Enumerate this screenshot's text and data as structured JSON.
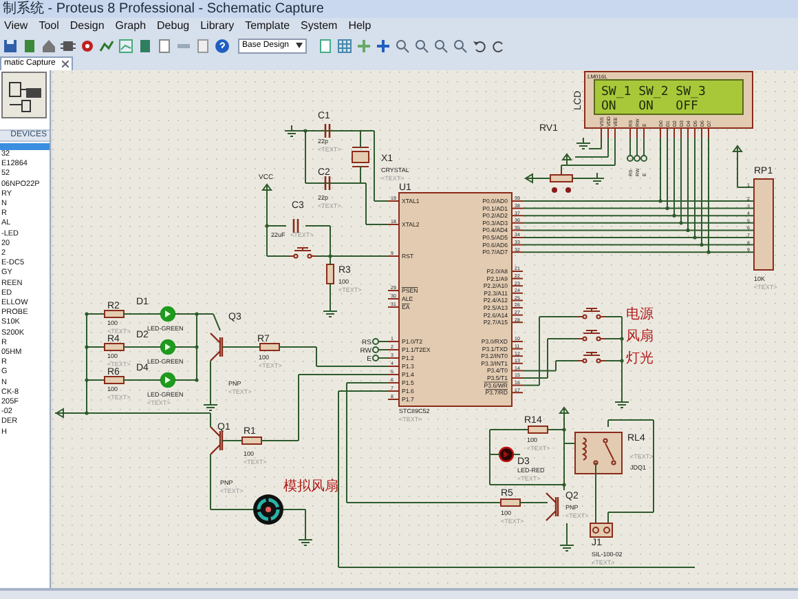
{
  "window": {
    "title": "制系统 - Proteus 8 Professional - Schematic Capture"
  },
  "menu": [
    "View",
    "Tool",
    "Design",
    "Graph",
    "Debug",
    "Library",
    "Template",
    "System",
    "Help"
  ],
  "toolbar": {
    "layer_select": "Base Design"
  },
  "tab": {
    "label": "matic Capture",
    "selected": true
  },
  "devices_panel": {
    "header": "DEVICES",
    "items": [
      "32",
      "E12864",
      "52",
      "06NPO22P",
      "RY",
      "N",
      "R",
      "AL",
      "-LED",
      "20",
      "2",
      "E-DC5",
      "GY",
      "REEN",
      "ED",
      "ELLOW",
      "PROBE",
      "S10K",
      "S200K",
      "R",
      "05HM",
      "R",
      "G",
      "N",
      "CK-8",
      "205F",
      "-02",
      "DER",
      "H"
    ]
  },
  "schematic": {
    "components": [
      {
        "ref": "C1",
        "value": "22p",
        "text": "<TEXT>"
      },
      {
        "ref": "C2",
        "value": "22p",
        "text": "<TEXT>"
      },
      {
        "ref": "X1",
        "value": "CRYSTAL",
        "text": "<TEXT>"
      },
      {
        "ref": "C3",
        "value": "22uF",
        "text": "<TEXT>"
      },
      {
        "ref": "R3",
        "value": "100",
        "text": "<TEXT>"
      },
      {
        "ref": "R2",
        "value": "100",
        "text": "<TEXT>"
      },
      {
        "ref": "R4",
        "value": "100",
        "text": "<TEXT>"
      },
      {
        "ref": "R6",
        "value": "100",
        "text": "<TEXT>"
      },
      {
        "ref": "D1",
        "value": "LED-GREEN"
      },
      {
        "ref": "D2",
        "value": "LED-GREEN"
      },
      {
        "ref": "D4",
        "value": "LED-GREEN",
        "text": "<TEXT>"
      },
      {
        "ref": "Q3",
        "value": "PNP",
        "text": "<TEXT>"
      },
      {
        "ref": "R7",
        "value": "100",
        "text": "<TEXT>"
      },
      {
        "ref": "U1",
        "value": "STC89C52",
        "text": "<TEXT>"
      },
      {
        "ref": "RV1"
      },
      {
        "ref": "RP1",
        "value": "10K",
        "text": "<TEXT>"
      },
      {
        "ref": "Q1",
        "value": "PNP",
        "text": "<TEXT>"
      },
      {
        "ref": "R1",
        "value": "100",
        "text": "<TEXT>"
      },
      {
        "ref": "R14",
        "value": "100",
        "text": "<TEXT>"
      },
      {
        "ref": "D3",
        "value": "LED-RED",
        "text": "<TEXT>"
      },
      {
        "ref": "RL4",
        "value": "JDQ1",
        "text": "<TEXT>"
      },
      {
        "ref": "R5",
        "value": "100",
        "text": "<TEXT>"
      },
      {
        "ref": "Q2",
        "value": "PNP",
        "text": "<TEXT>"
      },
      {
        "ref": "J1",
        "value": "SIL-100-02",
        "text": "<TEXT>"
      }
    ],
    "leds": [
      {
        "lit": true,
        "color": "#1f9a1f"
      },
      {
        "lit": true,
        "color": "#1f9a1f"
      },
      {
        "lit": true,
        "color": "#1f9a1f"
      },
      {
        "lit": false,
        "color": "#c01010"
      }
    ],
    "u1_left_pins": [
      {
        "label": "XTAL1",
        "number": "19",
        "overline": false
      },
      {
        "label": "XTAL2",
        "number": "18",
        "overline": false
      },
      {
        "label": "RST",
        "number": "9",
        "overline": false
      },
      {
        "label": "PSEN",
        "number": "29",
        "overline": true
      },
      {
        "label": "ALE",
        "number": "30",
        "overline": false
      },
      {
        "label": "EA",
        "number": "31",
        "overline": true
      },
      {
        "label": "P1.0/T2",
        "number": "1",
        "overline": false
      },
      {
        "label": "P1.1/T2EX",
        "number": "2",
        "overline": false
      },
      {
        "label": "P1.2",
        "number": "3",
        "overline": false
      },
      {
        "label": "P1.3",
        "number": "4",
        "overline": false
      },
      {
        "label": "P1.4",
        "number": "5",
        "overline": false
      },
      {
        "label": "P1.5",
        "number": "6",
        "overline": false
      },
      {
        "label": "P1.6",
        "number": "7",
        "overline": false
      },
      {
        "label": "P1.7",
        "number": "8",
        "overline": false
      }
    ],
    "u1_right_pins": [
      {
        "label": "P0.0/AD0",
        "number": "39",
        "overline": false
      },
      {
        "label": "P0.1/AD1",
        "number": "38",
        "overline": false
      },
      {
        "label": "P0.2/AD2",
        "number": "37",
        "overline": false
      },
      {
        "label": "P0.3/AD3",
        "number": "36",
        "overline": false
      },
      {
        "label": "P0.4/AD4",
        "number": "35",
        "overline": false
      },
      {
        "label": "P0.5/AD5",
        "number": "34",
        "overline": false
      },
      {
        "label": "P0.6/AD6",
        "number": "33",
        "overline": false
      },
      {
        "label": "P0.7/AD7",
        "number": "32",
        "overline": false
      },
      {
        "label": "P2.0/A8",
        "number": "21",
        "overline": false
      },
      {
        "label": "P2.1/A9",
        "number": "22",
        "overline": false
      },
      {
        "label": "P2.2/A10",
        "number": "23",
        "overline": false
      },
      {
        "label": "P2.3/A11",
        "number": "24",
        "overline": false
      },
      {
        "label": "P2.4/A12",
        "number": "25",
        "overline": false
      },
      {
        "label": "P2.5/A13",
        "number": "26",
        "overline": false
      },
      {
        "label": "P2.6/A14",
        "number": "27",
        "overline": false
      },
      {
        "label": "P2.7/A15",
        "number": "28",
        "overline": false
      },
      {
        "label": "P3.0/RXD",
        "number": "10",
        "overline": false
      },
      {
        "label": "P3.1/TXD",
        "number": "11",
        "overline": false
      },
      {
        "label": "P3.2/INT0",
        "number": "12",
        "overline": false
      },
      {
        "label": "P3.3/INT1",
        "number": "13",
        "overline": false
      },
      {
        "label": "P3.4/T0",
        "number": "14",
        "overline": false
      },
      {
        "label": "P3.5/T1",
        "number": "15",
        "overline": false
      },
      {
        "label": "P3.6/WR",
        "number": "16",
        "overline": true
      },
      {
        "label": "P3.7/RD",
        "number": "17",
        "overline": true
      }
    ],
    "lcd": {
      "ref": "LCD",
      "model": "LM016L",
      "lines": [
        "SW_1 SW_2 SW_3",
        "ON   ON   OFF"
      ],
      "pins": [
        "VSS",
        "VDD",
        "VEE",
        "RS",
        "RW",
        "E",
        "D0",
        "D1",
        "D2",
        "D3",
        "D4",
        "D5",
        "D6",
        "D7"
      ]
    },
    "rp1_pins": [
      "1",
      "2",
      "3",
      "4",
      "5",
      "6",
      "7",
      "8",
      "9"
    ],
    "net_labels": [
      "VCC",
      "RS",
      "RW",
      "E",
      "RS",
      "RW",
      "E"
    ],
    "button_labels": [
      "电源",
      "风扇",
      "灯光"
    ],
    "fan_label": "模拟风扇"
  }
}
